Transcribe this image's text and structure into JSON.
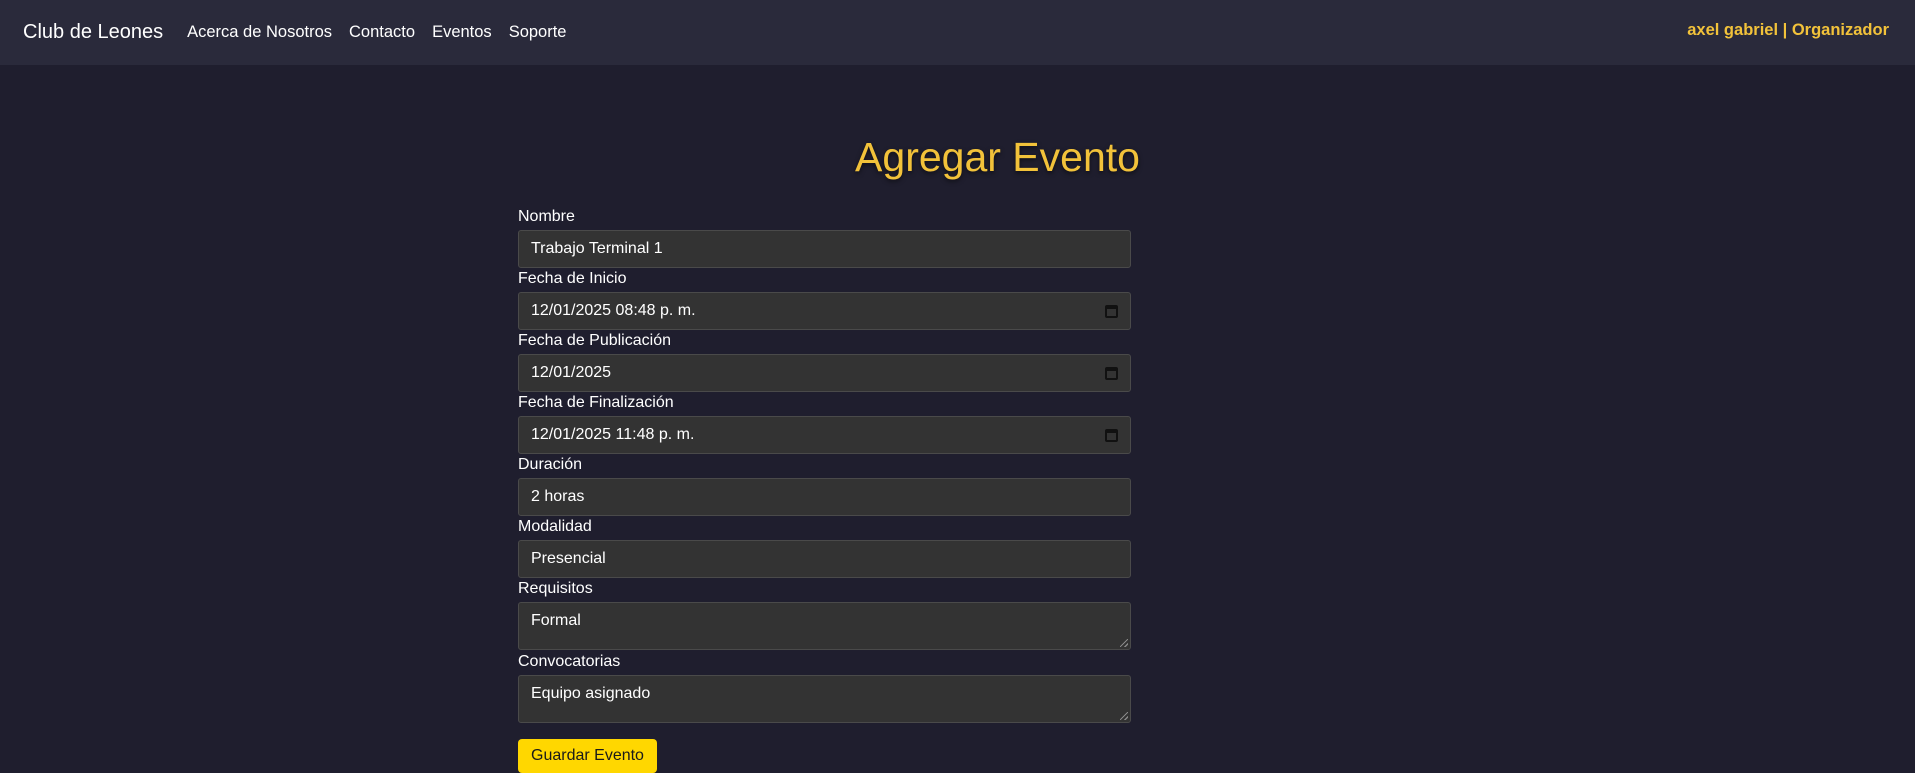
{
  "nav": {
    "brand": "Club de Leones",
    "links": [
      "Acerca de Nosotros",
      "Contacto",
      "Eventos",
      "Soporte"
    ],
    "user": "axel gabriel | Organizador"
  },
  "page": {
    "title": "Agregar Evento"
  },
  "form": {
    "nombre": {
      "label": "Nombre",
      "value": "Trabajo Terminal 1"
    },
    "fecha_inicio": {
      "label": "Fecha de Inicio",
      "value": "12/01/2025 08:48 p. m."
    },
    "fecha_publicacion": {
      "label": "Fecha de Publicación",
      "value": "12/01/2025"
    },
    "fecha_finalizacion": {
      "label": "Fecha de Finalización",
      "value": "12/01/2025 11:48 p. m."
    },
    "duracion": {
      "label": "Duración",
      "value": "2 horas"
    },
    "modalidad": {
      "label": "Modalidad",
      "value": "Presencial"
    },
    "requisitos": {
      "label": "Requisitos",
      "value": "Formal"
    },
    "convocatorias": {
      "label": "Convocatorias",
      "value": "Equipo asignado"
    },
    "submit_label": "Guardar Evento"
  },
  "colors": {
    "background": "#1f1e2e",
    "navbar": "#2a2a3b",
    "accent": "#f2c23a",
    "button": "#ffd700",
    "input_bg": "#333333"
  },
  "icons": {
    "date_picker": "calendar-icon"
  }
}
